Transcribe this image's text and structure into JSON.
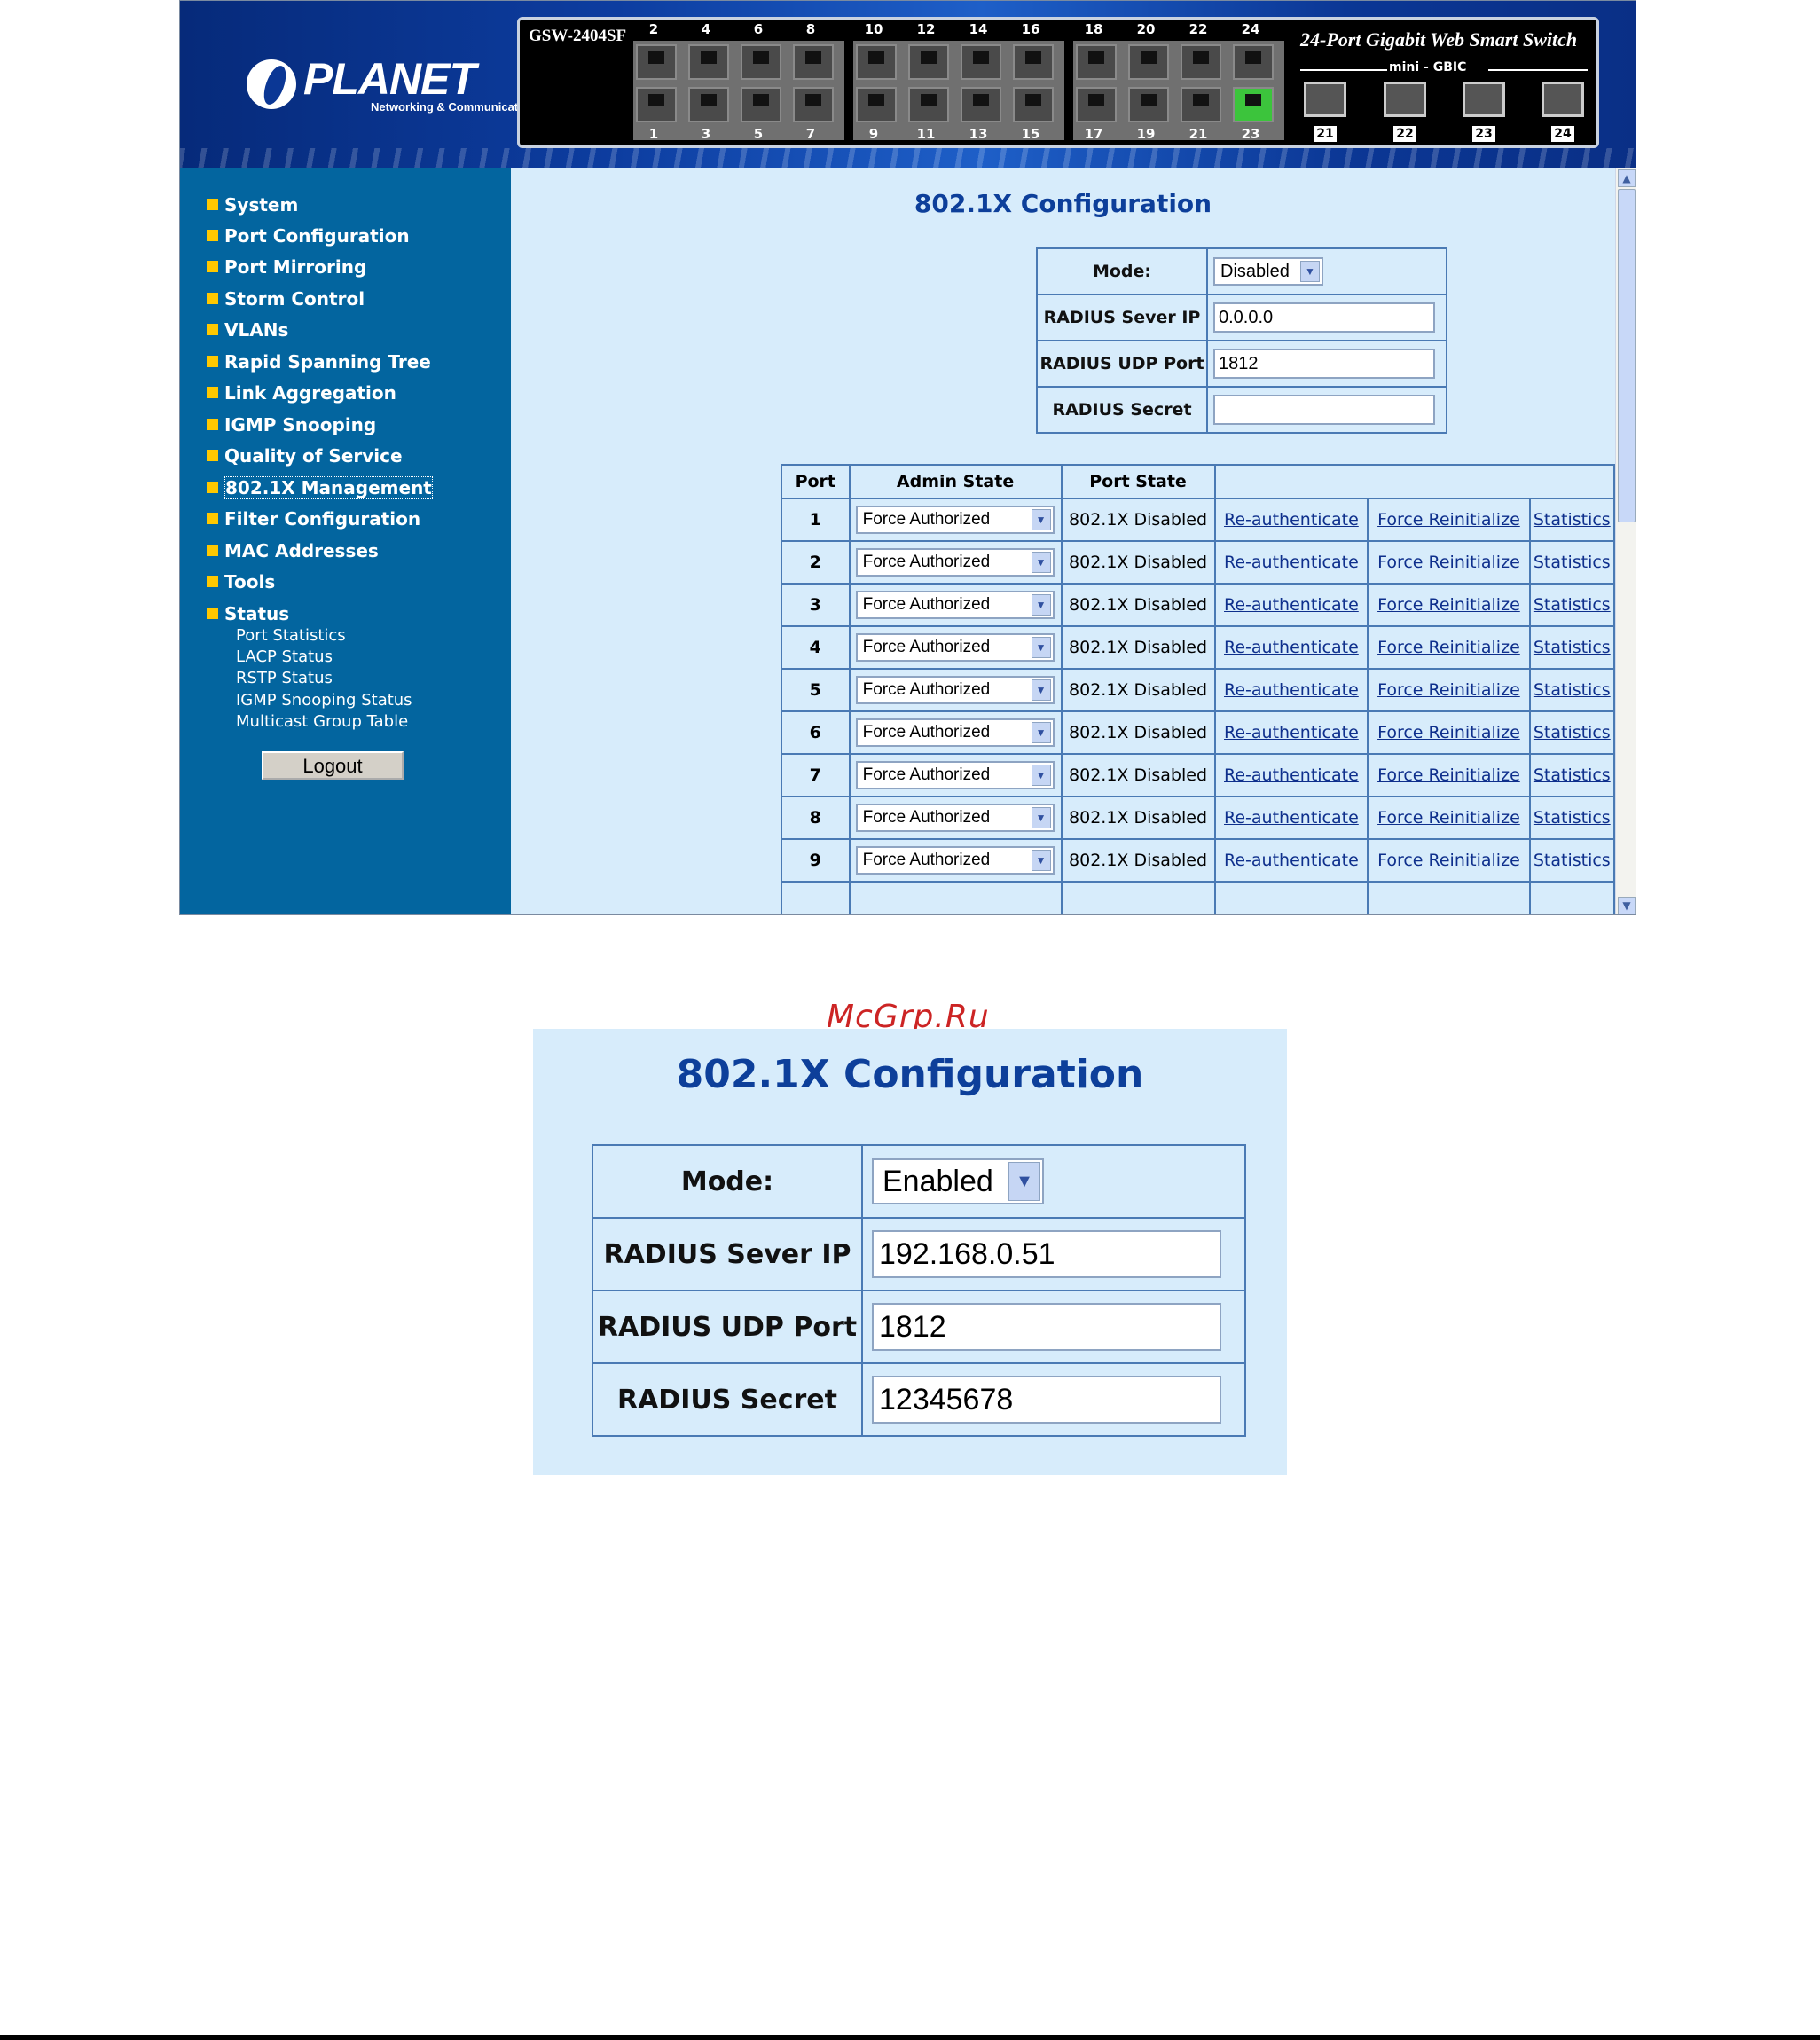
{
  "header": {
    "brand": "PLANET",
    "brand_tagline": "Networking & Communication",
    "switch_model": "GSW-2404SF",
    "switch_title": "24-Port Gigabit Web Smart Switch",
    "switch_subtitle": "mini - GBIC",
    "ports_top": [
      "2",
      "4",
      "6",
      "8",
      "10",
      "12",
      "14",
      "16",
      "18",
      "20",
      "22",
      "24"
    ],
    "ports_bottom": [
      "1",
      "3",
      "5",
      "7",
      "9",
      "11",
      "13",
      "15",
      "17",
      "19",
      "21",
      "23"
    ],
    "sfp_ports": [
      "21",
      "22",
      "23",
      "24"
    ]
  },
  "sidebar": {
    "items": [
      {
        "label": "System"
      },
      {
        "label": "Port Configuration"
      },
      {
        "label": "Port Mirroring"
      },
      {
        "label": "Storm Control"
      },
      {
        "label": "VLANs"
      },
      {
        "label": "Rapid Spanning Tree"
      },
      {
        "label": "Link Aggregation"
      },
      {
        "label": "IGMP Snooping"
      },
      {
        "label": "Quality of Service"
      },
      {
        "label": "802.1X Management"
      },
      {
        "label": "Filter Configuration"
      },
      {
        "label": "MAC Addresses"
      },
      {
        "label": "Tools"
      },
      {
        "label": "Status"
      }
    ],
    "status_sub": [
      "Port Statistics",
      "LACP Status",
      "RSTP Status",
      "IGMP Snooping Status",
      "Multicast Group Table"
    ],
    "logout_label": "Logout"
  },
  "main": {
    "title": "802.1X Configuration",
    "labels": {
      "mode": "Mode:",
      "server_ip": "RADIUS Sever IP",
      "udp_port": "RADIUS UDP Port",
      "secret": "RADIUS Secret"
    },
    "mode_value": "Disabled",
    "server_ip_value": "0.0.0.0",
    "udp_port_value": "1812",
    "secret_value": "",
    "table_headers": {
      "port": "Port",
      "admin": "Admin State",
      "state": "Port State"
    },
    "rows": [
      {
        "port": "1",
        "admin": "Force Authorized",
        "state": "802.1X Disabled"
      },
      {
        "port": "2",
        "admin": "Force Authorized",
        "state": "802.1X Disabled"
      },
      {
        "port": "3",
        "admin": "Force Authorized",
        "state": "802.1X Disabled"
      },
      {
        "port": "4",
        "admin": "Force Authorized",
        "state": "802.1X Disabled"
      },
      {
        "port": "5",
        "admin": "Force Authorized",
        "state": "802.1X Disabled"
      },
      {
        "port": "6",
        "admin": "Force Authorized",
        "state": "802.1X Disabled"
      },
      {
        "port": "7",
        "admin": "Force Authorized",
        "state": "802.1X Disabled"
      },
      {
        "port": "8",
        "admin": "Force Authorized",
        "state": "802.1X Disabled"
      },
      {
        "port": "9",
        "admin": "Force Authorized",
        "state": "802.1X Disabled"
      }
    ],
    "link_reauth": "Re-authenticate",
    "link_reinit": "Force Reinitialize",
    "link_stats": "Statistics"
  },
  "watermark": "McGrp.Ru",
  "detail": {
    "title": "802.1X Configuration",
    "labels": {
      "mode": "Mode:",
      "server_ip": "RADIUS Sever IP",
      "udp_port": "RADIUS UDP Port",
      "secret": "RADIUS Secret"
    },
    "mode_value": "Enabled",
    "server_ip_value": "192.168.0.51",
    "udp_port_value": "1812",
    "secret_value": "12345678"
  },
  "colors": {
    "banner": "#0b3795",
    "sidebar": "#03659f",
    "content": "#d7ecfb",
    "bullet": "#ffc800",
    "title": "#0d3f9a",
    "link": "#0e2f8c",
    "table_border": "#4a7ab4",
    "active_port": "#3cc43c",
    "watermark": "#cc2424"
  }
}
